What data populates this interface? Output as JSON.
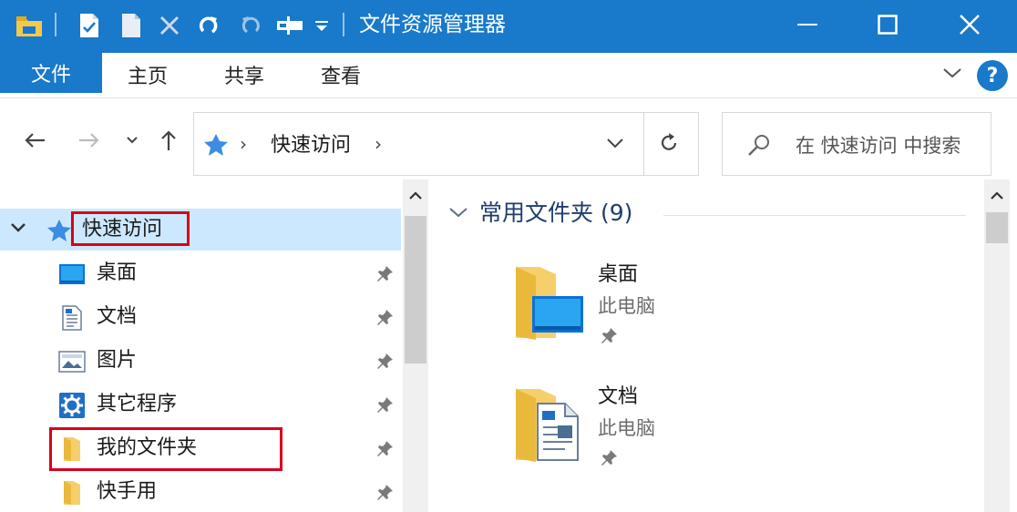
{
  "window": {
    "title": "文件资源管理器",
    "accent_color": "#1979ca",
    "highlight_color": "#d6001c",
    "selection_color": "#cce8ff"
  },
  "quick_access_toolbar": {
    "icons": [
      "folder-icon",
      "properties-icon",
      "new-document-icon",
      "delete-icon",
      "redo-icon",
      "undo-icon",
      "rename-icon",
      "customize-dropdown-icon"
    ]
  },
  "ribbon": {
    "file_tab": "文件",
    "tabs": [
      "主页",
      "共享",
      "查看"
    ],
    "help_label": "?"
  },
  "navigation": {
    "address_path": "快速访问",
    "address_separator": "›",
    "search_placeholder": "在 快速访问 中搜索"
  },
  "nav_pane": {
    "items": [
      {
        "label": "快速访问",
        "icon": "star-icon",
        "selected": true,
        "highlighted": true
      },
      {
        "label": "桌面",
        "icon": "desktop-icon",
        "pinned": true
      },
      {
        "label": "文档",
        "icon": "document-icon",
        "pinned": true
      },
      {
        "label": "图片",
        "icon": "pictures-icon",
        "pinned": true
      },
      {
        "label": "其它程序",
        "icon": "gear-icon",
        "pinned": true
      },
      {
        "label": "我的文件夹",
        "icon": "folder-icon",
        "pinned": true,
        "highlighted": true
      },
      {
        "label": "快手用",
        "icon": "folder-icon",
        "pinned": true
      }
    ]
  },
  "content": {
    "group_title": "常用文件夹 (9)",
    "folders": [
      {
        "name": "桌面",
        "location": "此电脑",
        "icon": "desktop-folder-icon"
      },
      {
        "name": "文档",
        "location": "此电脑",
        "icon": "documents-folder-icon"
      }
    ]
  }
}
